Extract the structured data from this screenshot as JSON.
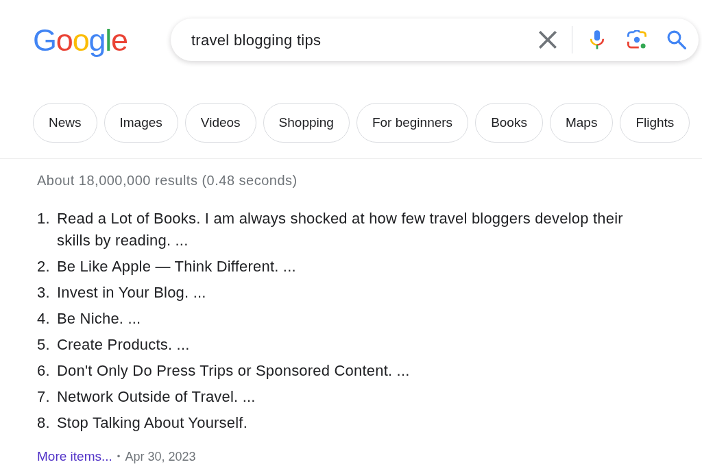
{
  "logo": "Google",
  "search": {
    "value": "travel blogging tips"
  },
  "chips": [
    "News",
    "Images",
    "Videos",
    "Shopping",
    "For beginners",
    "Books",
    "Maps",
    "Flights"
  ],
  "results": {
    "stats": "About 18,000,000 results (0.48 seconds)",
    "list": [
      {
        "number": "1.",
        "text": "Read a Lot of Books. I am always shocked at how few travel bloggers develop their skills by reading. ..."
      },
      {
        "number": "2.",
        "text": "Be Like Apple — Think Different. ..."
      },
      {
        "number": "3.",
        "text": "Invest in Your Blog. ..."
      },
      {
        "number": "4.",
        "text": "Be Niche. ..."
      },
      {
        "number": "5.",
        "text": "Create Products. ..."
      },
      {
        "number": "6.",
        "text": "Don't Only Do Press Trips or Sponsored Content. ..."
      },
      {
        "number": "7.",
        "text": "Network Outside of Travel. ..."
      },
      {
        "number": "8.",
        "text": "Stop Talking About Yourself."
      }
    ],
    "more_link": "More items...",
    "separator": "•",
    "date": "Apr 30, 2023"
  }
}
